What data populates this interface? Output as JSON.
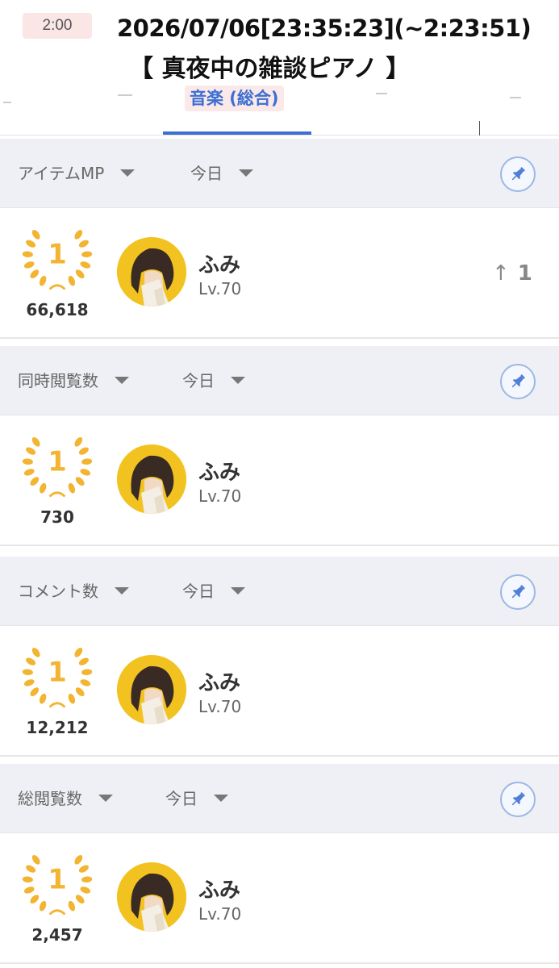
{
  "header": {
    "duration": "2:00",
    "timestamp": "2026/07/06[23:35:23](~2:23:51)",
    "stream_title": "【 真夜中の雑談ピアノ 】",
    "category_tab": "音楽 (総合)"
  },
  "colors": {
    "accent": "#3b6fd4",
    "section_bg": "#eef0f5",
    "badge_gold": "#f2b431",
    "pin_outline": "#9cb8e4"
  },
  "sections": [
    {
      "metric": "アイテムMP",
      "period": "今日",
      "pin_icon": "pin-icon",
      "entry": {
        "rank": "1",
        "value": "66,618",
        "name": "ふみ",
        "level": "Lv.70",
        "change_arrow": "↑",
        "change": "1"
      }
    },
    {
      "metric": "同時閲覧数",
      "period": "今日",
      "pin_icon": "pin-icon",
      "entry": {
        "rank": "1",
        "value": "730",
        "name": "ふみ",
        "level": "Lv.70"
      }
    },
    {
      "metric": "コメント数",
      "period": "今日",
      "pin_icon": "pin-icon",
      "entry": {
        "rank": "1",
        "value": "12,212",
        "name": "ふみ",
        "level": "Lv.70"
      }
    },
    {
      "metric": "総閲覧数",
      "period": "今日",
      "pin_icon": "pin-icon",
      "entry": {
        "rank": "1",
        "value": "2,457",
        "name": "ふみ",
        "level": "Lv.70"
      }
    }
  ]
}
